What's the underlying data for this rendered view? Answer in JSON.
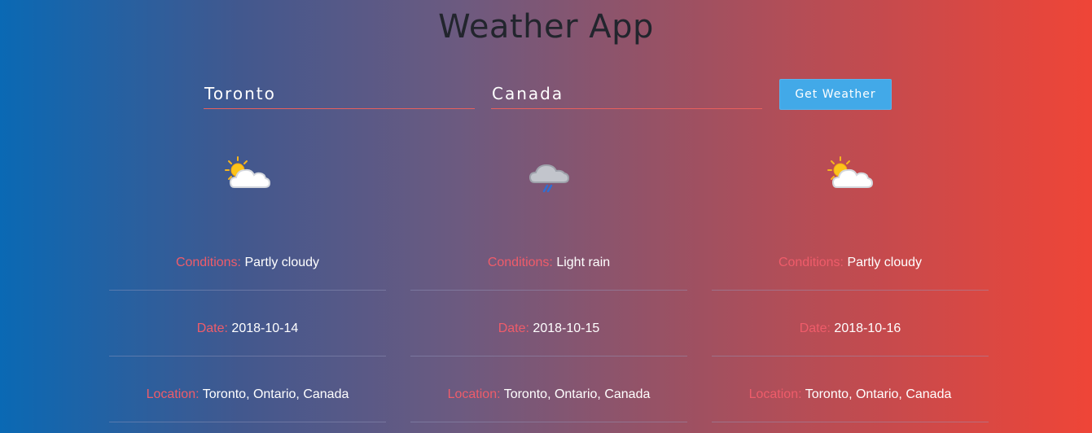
{
  "app": {
    "title": "Weather App"
  },
  "form": {
    "city_value": "Toronto",
    "country_value": "Canada",
    "button_label": "Get Weather"
  },
  "labels": {
    "conditions": "Conditions:",
    "date": "Date:",
    "location": "Location:"
  },
  "forecast": [
    {
      "icon": "partly-cloudy-icon",
      "conditions": "Partly cloudy",
      "date": "2018-10-14",
      "location": "Toronto, Ontario, Canada"
    },
    {
      "icon": "light-rain-icon",
      "conditions": "Light rain",
      "date": "2018-10-15",
      "location": "Toronto, Ontario, Canada"
    },
    {
      "icon": "partly-cloudy-icon",
      "conditions": "Partly cloudy",
      "date": "2018-10-16",
      "location": "Toronto, Ontario, Canada"
    }
  ],
  "colors": {
    "label": "#ef5c6a",
    "button": "#42a9e8",
    "title": "#22252d"
  }
}
